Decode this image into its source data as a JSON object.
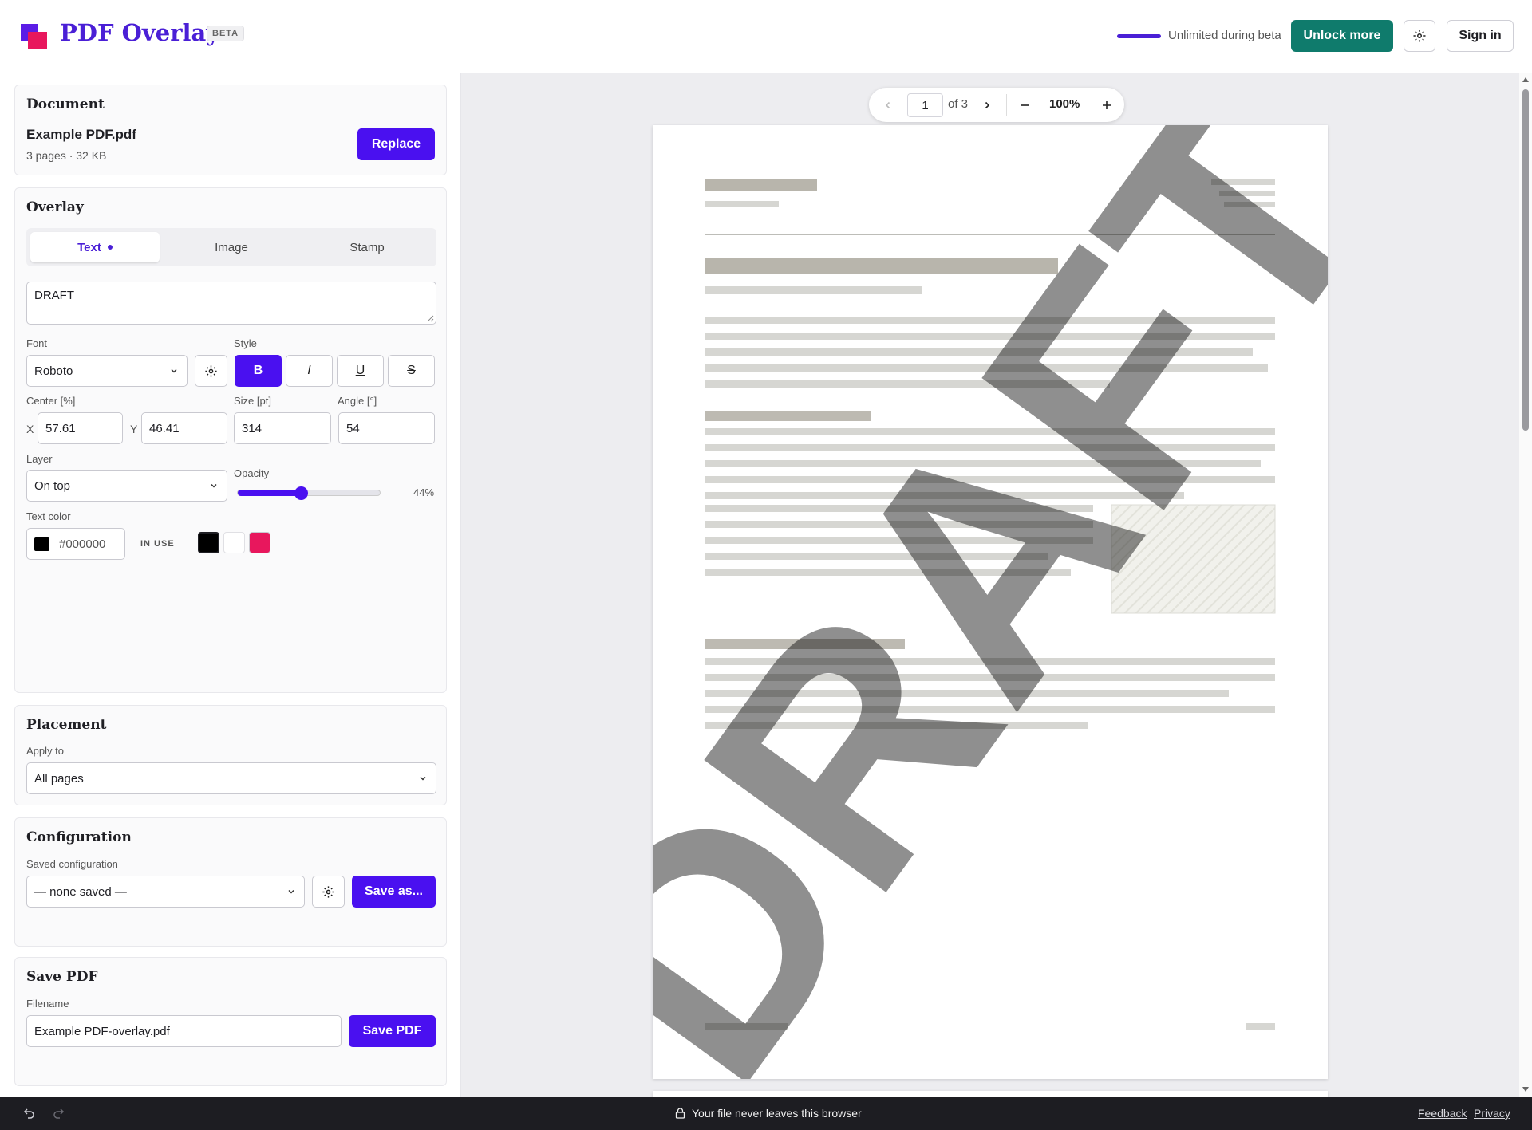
{
  "header": {
    "app_title": "PDF Overlay",
    "beta_badge": "BETA",
    "beta_status": "Unlimited during beta",
    "unlock_label": "Unlock more",
    "signin_label": "Sign in",
    "brand_color": "#4a1fd6",
    "accent_green": "#0f7b6c"
  },
  "document": {
    "title": "Document",
    "filename": "Example PDF.pdf",
    "meta": "3 pages · 32 KB",
    "replace_label": "Replace"
  },
  "overlay": {
    "title": "Overlay",
    "tabs": [
      {
        "label": "Text",
        "active": true
      },
      {
        "label": "Image",
        "active": false
      },
      {
        "label": "Stamp",
        "active": false
      }
    ],
    "text_value": "DRAFT",
    "font_label": "Font",
    "font_value": "Roboto",
    "style_label": "Style",
    "style_buttons": [
      {
        "label": "B",
        "name": "bold",
        "active": true
      },
      {
        "label": "I",
        "name": "italic",
        "active": false
      },
      {
        "label": "U",
        "name": "underline",
        "active": false
      },
      {
        "label": "S",
        "name": "strikethrough",
        "active": false
      }
    ],
    "center_label": "Center [%]",
    "x_label": "X",
    "x_value": "57.61",
    "y_label": "Y",
    "y_value": "46.41",
    "size_label": "Size [pt]",
    "size_value": "314",
    "angle_label": "Angle [°]",
    "angle_value": "54",
    "layer_label": "Layer",
    "layer_value": "On top",
    "opacity_label": "Opacity",
    "opacity_value": "44%",
    "opacity_fraction": 0.44,
    "text_color_label": "Text color",
    "text_color_value": "#000000",
    "in_use_label": "IN USE",
    "in_use_colors": [
      "#000000",
      "#ffffff",
      "#e8175d"
    ]
  },
  "placement": {
    "title": "Placement",
    "apply_label": "Apply to",
    "apply_value": "All pages"
  },
  "configuration": {
    "title": "Configuration",
    "saved_label": "Saved configuration",
    "saved_value": "— none saved —",
    "save_as_label": "Save as..."
  },
  "save_pdf": {
    "title": "Save PDF",
    "filename_label": "Filename",
    "filename_value": "Example PDF-overlay.pdf",
    "save_label": "Save PDF"
  },
  "viewer": {
    "page_current": "1",
    "page_total_text": "of 3",
    "zoom": "100%",
    "watermark_text": "DRAFT"
  },
  "footer": {
    "privacy_note": "Your file never leaves this browser",
    "feedback_link": "Feedback",
    "privacy_link": "Privacy"
  }
}
